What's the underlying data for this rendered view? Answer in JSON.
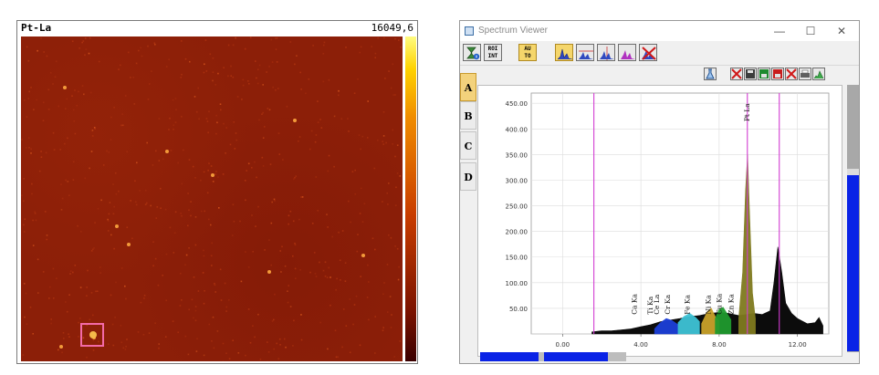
{
  "map": {
    "label": "Pt-La",
    "max_value": "16049,6"
  },
  "viewer": {
    "title": "Spectrum Viewer",
    "window_controls": {
      "minimize": "—",
      "maximize": "☐",
      "close": "✕"
    },
    "toolbar": [
      {
        "name": "scale-button",
        "text": ""
      },
      {
        "name": "roi-int-button",
        "text": "ROI INT"
      },
      {
        "name": "auto-button",
        "text": "AU TO"
      },
      {
        "name": "spectrum-view-1-button",
        "text": ""
      },
      {
        "name": "spectrum-view-2-button",
        "text": ""
      },
      {
        "name": "spectrum-view-3-button",
        "text": ""
      },
      {
        "name": "spectrum-view-4-button",
        "text": ""
      },
      {
        "name": "spectrum-clear-button",
        "text": ""
      }
    ],
    "tabs": [
      "A",
      "B",
      "C",
      "D"
    ],
    "active_tab": "A",
    "colors": {
      "accent_yellow": "#f5d66b",
      "scroll_blue": "#0a23e6",
      "marker_magenta": "#d23cd2",
      "pt_peak_olive": "#7f7a1e"
    }
  },
  "chart_data": {
    "type": "area",
    "xlim": [
      -1.6,
      13.6
    ],
    "ylim": [
      0,
      470
    ],
    "xticks": [
      0.0,
      4.0,
      8.0,
      12.0
    ],
    "xtick_labels": [
      "0.00",
      "4.00",
      "8.00",
      "12.00"
    ],
    "yticks": [
      0,
      50,
      100,
      150,
      200,
      250,
      300,
      350,
      400,
      450
    ],
    "ytick_labels": [
      "",
      "50.00",
      "100.00",
      "150.00",
      "200.00",
      "250.00",
      "300.00",
      "350.00",
      "400.00",
      "450.00"
    ],
    "grid": true,
    "markers_kev": [
      1.6,
      9.44,
      11.07
    ],
    "peak_labels": [
      {
        "label": "Ca Ka",
        "x": 3.69
      },
      {
        "label": "Ti Ka",
        "x": 4.51
      },
      {
        "label": "Ce La",
        "x": 4.84
      },
      {
        "label": "Cr Ka",
        "x": 5.41
      },
      {
        "label": "Fe Ka",
        "x": 6.4
      },
      {
        "label": "Ni Ka",
        "x": 7.47
      },
      {
        "label": "Cu Ka",
        "x": 8.04
      },
      {
        "label": "Zn Ka",
        "x": 8.63
      },
      {
        "label": "Pt La",
        "x": 9.44
      }
    ],
    "series": [
      {
        "color": "#000000",
        "points": [
          [
            1.5,
            4
          ],
          [
            2.0,
            6
          ],
          [
            2.5,
            6
          ],
          [
            3.0,
            8
          ],
          [
            3.5,
            10
          ],
          [
            4.0,
            14
          ],
          [
            4.5,
            18
          ],
          [
            5.0,
            24
          ],
          [
            5.5,
            27
          ],
          [
            6.0,
            30
          ],
          [
            6.5,
            34
          ],
          [
            7.0,
            36
          ],
          [
            7.5,
            40
          ],
          [
            8.0,
            42
          ],
          [
            8.5,
            40
          ],
          [
            9.0,
            36
          ],
          [
            9.8,
            40
          ],
          [
            10.2,
            38
          ],
          [
            10.6,
            45
          ],
          [
            10.8,
            100
          ],
          [
            11.0,
            170
          ],
          [
            11.2,
            120
          ],
          [
            11.4,
            60
          ],
          [
            11.7,
            40
          ],
          [
            12.0,
            30
          ],
          [
            12.5,
            20
          ],
          [
            12.9,
            22
          ],
          [
            13.1,
            32
          ],
          [
            13.3,
            16
          ]
        ]
      },
      {
        "color": "#1c3fd8",
        "points": [
          [
            4.7,
            10
          ],
          [
            5.0,
            22
          ],
          [
            5.3,
            30
          ],
          [
            5.6,
            26
          ],
          [
            5.9,
            18
          ]
        ]
      },
      {
        "color": "#3ec3d6",
        "points": [
          [
            5.9,
            22
          ],
          [
            6.2,
            34
          ],
          [
            6.5,
            40
          ],
          [
            6.8,
            32
          ],
          [
            7.0,
            24
          ]
        ]
      },
      {
        "color": "#c8a12a",
        "points": [
          [
            7.1,
            20
          ],
          [
            7.4,
            44
          ],
          [
            7.6,
            50
          ],
          [
            7.8,
            34
          ],
          [
            8.0,
            26
          ]
        ]
      },
      {
        "color": "#1f9a2e",
        "points": [
          [
            7.8,
            30
          ],
          [
            8.0,
            48
          ],
          [
            8.2,
            52
          ],
          [
            8.4,
            40
          ],
          [
            8.6,
            28
          ]
        ]
      },
      {
        "color": "#7f7a1e",
        "points": [
          [
            9.0,
            30
          ],
          [
            9.2,
            120
          ],
          [
            9.35,
            280
          ],
          [
            9.45,
            350
          ],
          [
            9.55,
            240
          ],
          [
            9.7,
            80
          ],
          [
            9.85,
            30
          ]
        ]
      }
    ]
  }
}
